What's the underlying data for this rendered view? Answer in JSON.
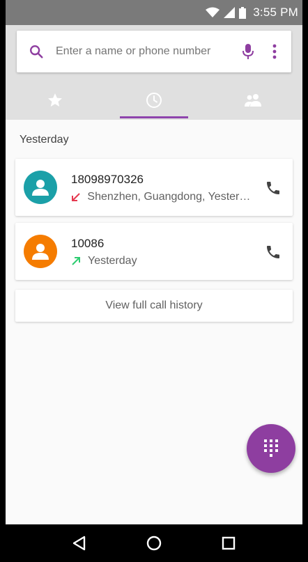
{
  "status_bar": {
    "time": "3:55 PM"
  },
  "search": {
    "placeholder": "Enter a name or phone number"
  },
  "tabs": [
    {
      "icon": "star-icon",
      "active": false
    },
    {
      "icon": "clock-icon",
      "active": true
    },
    {
      "icon": "contacts-icon",
      "active": false
    }
  ],
  "section": {
    "title": "Yesterday"
  },
  "calls": [
    {
      "name": "18098970326",
      "detail": "Shenzhen, Guangdong, Yesterday",
      "direction": "incoming-missed",
      "avatar_color": "#1ba0a8",
      "arrow_color": "#e53950"
    },
    {
      "name": "10086",
      "detail": "Yesterday",
      "direction": "outgoing",
      "avatar_color": "#f57c00",
      "arrow_color": "#2ecc71"
    }
  ],
  "history": {
    "label": "View full call history"
  },
  "colors": {
    "accent": "#8e3ea0",
    "header_bg": "#e0e0e0",
    "status_bar_bg": "#7a7a7a"
  }
}
